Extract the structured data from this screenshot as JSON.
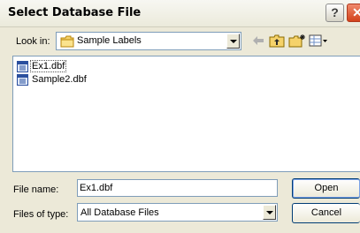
{
  "window": {
    "title": "Select Database File",
    "help_glyph": "?",
    "close_glyph": "✕"
  },
  "lookin": {
    "label": "Look in:",
    "value": "Sample Labels"
  },
  "toolbar": {
    "icons": [
      "back-arrow-icon",
      "up-folder-icon",
      "new-folder-icon",
      "view-menu-icon"
    ]
  },
  "files": [
    {
      "name": "Ex1.dbf",
      "selected": true
    },
    {
      "name": "Sample2.dbf",
      "selected": false
    }
  ],
  "file_name": {
    "label": "File name:",
    "value": "Ex1.dbf"
  },
  "file_type": {
    "label": "Files of type:",
    "value": "All Database Files"
  },
  "buttons": {
    "open": "Open",
    "cancel": "Cancel"
  },
  "colors": {
    "dialog_bg": "#ece9d8",
    "border": "#7f9db9",
    "close_red": "#d2421b",
    "folder_yellow": "#f5d26a"
  }
}
